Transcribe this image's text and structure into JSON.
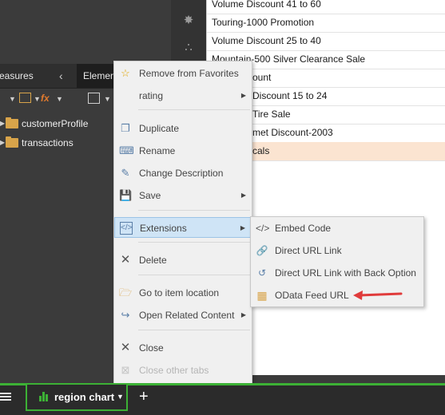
{
  "colors": {
    "accent_green": "#3cb135",
    "selected_row": "#fbe4d1",
    "menu_highlight": "#cfe4f6",
    "arrow_red": "#e03b3b",
    "folder": "#d8a44a"
  },
  "left_panel": {
    "tab_measures": "easures",
    "tab_elements": "Elemen",
    "tree": [
      {
        "label": "customerProfile",
        "icon": "folder-icon"
      },
      {
        "label": "transactions",
        "icon": "folder-icon"
      }
    ]
  },
  "list_rows": [
    "Volume Discount 41 to 60",
    "Touring-1000 Promotion",
    "Volume Discount 25 to 40",
    "Mountain-500 Silver Clearance Sale",
    "ount",
    "Discount 15 to 24",
    "Tire Sale",
    "met Discount-2003",
    "cals"
  ],
  "context_menu": {
    "items": {
      "remove_favorites": "Remove from Favorites",
      "rating": "rating",
      "duplicate": "Duplicate",
      "rename": "Rename",
      "change_description": "Change Description",
      "save": "Save",
      "extensions": "Extensions",
      "delete": "Delete",
      "go_to_location": "Go to item location",
      "open_related": "Open Related Content",
      "close": "Close",
      "close_other_tabs": "Close other tabs"
    }
  },
  "submenu": {
    "items": {
      "embed_code": "Embed Code",
      "direct_url": "Direct URL Link",
      "direct_url_back": "Direct URL Link with Back Option",
      "odata_feed": "OData Feed URL"
    }
  },
  "bottom_bar": {
    "tab_label": "region chart",
    "add_symbol": "+"
  }
}
